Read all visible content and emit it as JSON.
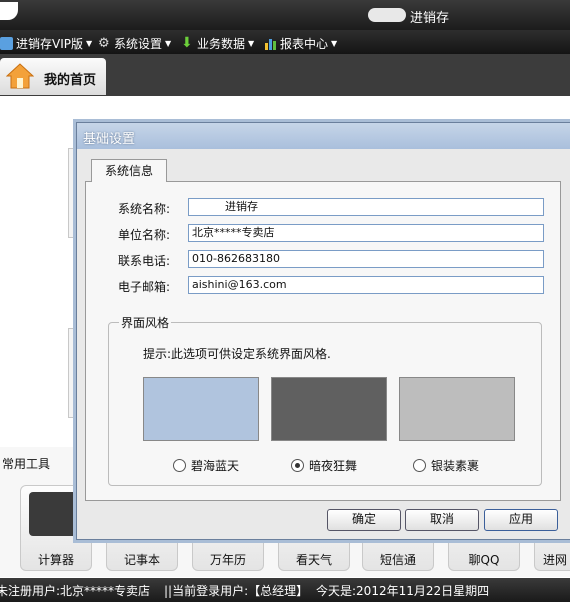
{
  "window": {
    "title": "进销存"
  },
  "menu": {
    "items": [
      {
        "label": "进销存VIP版",
        "icon": "vip-icon"
      },
      {
        "label": "系统设置",
        "icon": "gear-icon"
      },
      {
        "label": "业务数据",
        "icon": "download-arrow-icon"
      },
      {
        "label": "报表中心",
        "icon": "bar-chart-icon"
      }
    ]
  },
  "tabs": {
    "home_label": "我的首页"
  },
  "dialog": {
    "title": "基础设置",
    "tab_label": "系统信息",
    "fields": {
      "system_name_label": "系统名称:",
      "system_name_value": "进销存",
      "company_label": "单位名称:",
      "company_value": "北京*****专卖店",
      "phone_label": "联系电话:",
      "phone_value": "010-862683180",
      "email_label": "电子邮箱:",
      "email_value": "aishini@163.com"
    },
    "style_group": {
      "legend": "界面风格",
      "hint": "提示:此选项可供设定系统界面风格.",
      "options": [
        {
          "label": "碧海蓝天",
          "color": "#b0c4de",
          "selected": false
        },
        {
          "label": "暗夜狂舞",
          "color": "#606060",
          "selected": true
        },
        {
          "label": "银装素裹",
          "color": "#bdbdbd",
          "selected": false
        }
      ]
    },
    "buttons": {
      "ok": "确定",
      "cancel": "取消",
      "apply": "应用"
    }
  },
  "tools": {
    "label": "常用工具",
    "items": [
      "计算器",
      "记事本",
      "万年历",
      "看天气",
      "短信通",
      "聊QQ",
      "进网"
    ]
  },
  "status": {
    "registered": "未注册用户:北京*****专卖店",
    "current_user": "||当前登录用户:【总经理】",
    "today": "今天是:2012年11月22日星期四"
  }
}
